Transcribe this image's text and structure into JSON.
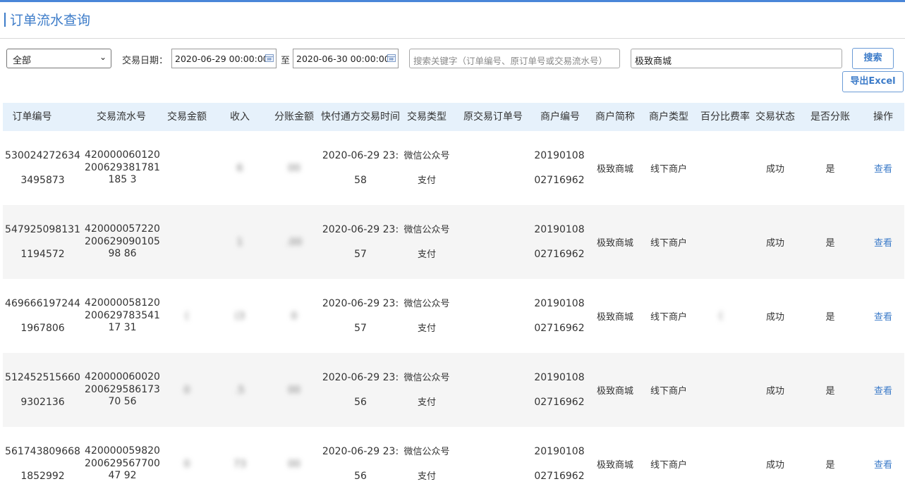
{
  "page": {
    "title": "订单流水查询"
  },
  "filters": {
    "type_select": "全部",
    "date_label": "交易日期：",
    "date_start": "2020-06-29 00:00:00",
    "date_sep": "至",
    "date_end": "2020-06-30 00:00:00",
    "keyword_placeholder": "搜索关键字（订单编号、原订单号或交易流水号）",
    "merchant_value": "极致商城",
    "search_label": "搜索",
    "export_label": "导出Excel"
  },
  "table": {
    "headers": [
      "订单编号",
      "交易流水号",
      "交易金额",
      "收入",
      "分账金额",
      "快付通方交易时间",
      "交易类型",
      "原交易订单号",
      "商户编号",
      "商户简称",
      "商户类型",
      "百分比费率",
      "交易状态",
      "是否分账",
      "操作"
    ],
    "rows": [
      {
        "order_no": "5300242726343495873",
        "txn_no": "420000060120200629381781185 3",
        "amount": "",
        "income": "6",
        "split": "00",
        "time": "2020-06-29 23:58",
        "type": "微信公众号支付",
        "orig_no": "",
        "merchant_no": "2019010802716962",
        "merchant_name": "极致商城",
        "merchant_type": "线下商户",
        "rate": "",
        "status": "成功",
        "is_split": "是",
        "action": "查看"
      },
      {
        "order_no": "5479250981311194572",
        "txn_no": "42000005722020062909010598 86",
        "amount": "",
        "income": "1",
        "split": ".00",
        "time": "2020-06-29 23:57",
        "type": "微信公众号支付",
        "orig_no": "",
        "merchant_no": "2019010802716962",
        "merchant_name": "极致商城",
        "merchant_type": "线下商户",
        "rate": "",
        "status": "成功",
        "is_split": "是",
        "action": "查看"
      },
      {
        "order_no": "4696661972441967806",
        "txn_no": "42000005812020062978354117 31",
        "amount": "(",
        "income": "(3",
        "split": "0",
        "time": "2020-06-29 23:57",
        "type": "微信公众号支付",
        "orig_no": "",
        "merchant_no": "2019010802716962",
        "merchant_name": "极致商城",
        "merchant_type": "线下商户",
        "rate": "(",
        "status": "成功",
        "is_split": "是",
        "action": "查看"
      },
      {
        "order_no": "5124525156609302136",
        "txn_no": "42000006002020062958617370 56",
        "amount": "0",
        "income": ".5",
        "split": "00",
        "time": "2020-06-29 23:56",
        "type": "微信公众号支付",
        "orig_no": "",
        "merchant_no": "2019010802716962",
        "merchant_name": "极致商城",
        "merchant_type": "线下商户",
        "rate": "",
        "status": "成功",
        "is_split": "是",
        "action": "查看"
      },
      {
        "order_no": "5617438096681852992",
        "txn_no": "42000005982020062956770047 92",
        "amount": "0",
        "income": "73",
        "split": "00",
        "time": "2020-06-29 23:56",
        "type": "微信公众号支付",
        "orig_no": "",
        "merchant_no": "2019010802716962",
        "merchant_name": "极致商城",
        "merchant_type": "线下商户",
        "rate": "",
        "status": "成功",
        "is_split": "是",
        "action": "查看"
      }
    ]
  },
  "colors": {
    "accent": "#3d7cc9",
    "header_bg": "#e6f1fb",
    "alt_row": "#f5f5f5",
    "top_bar": "#4a86d8"
  }
}
